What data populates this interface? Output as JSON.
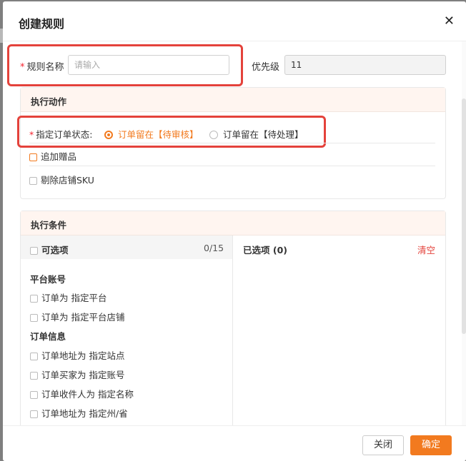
{
  "dialog": {
    "title": "创建规则",
    "close_glyph": "✕"
  },
  "form": {
    "rule_name_label": "规则名称",
    "rule_name_placeholder": "请输入",
    "priority_label": "优先级",
    "priority_value": "11"
  },
  "action_section": {
    "title": "执行动作",
    "status_label": "指定订单状态:",
    "status_options": [
      {
        "label": "订单留在【待审核】",
        "selected": true
      },
      {
        "label": "订单留在【待处理】",
        "selected": false
      }
    ],
    "checkboxes": [
      {
        "label": "追加赠品"
      },
      {
        "label": "剔除店铺SKU"
      }
    ]
  },
  "condition_section": {
    "title": "执行条件",
    "available_header": "可选项",
    "available_count": "0/15",
    "selected_header": "已选项 (0)",
    "clear_label": "清空",
    "groups": [
      {
        "title": "平台账号",
        "items": [
          "订单为 指定平台",
          "订单为 指定平台店铺"
        ]
      },
      {
        "title": "订单信息",
        "items": [
          "订单地址为 指定站点",
          "订单买家为 指定账号",
          "订单收件人为 指定名称",
          "订单地址为 指定州/省"
        ]
      }
    ]
  },
  "footer": {
    "close_label": "关闭",
    "ok_label": "确定"
  },
  "colors": {
    "accent": "#f27a1f",
    "highlight_box": "#e4423b",
    "required": "#f5222d",
    "clear": "#e4423b"
  }
}
